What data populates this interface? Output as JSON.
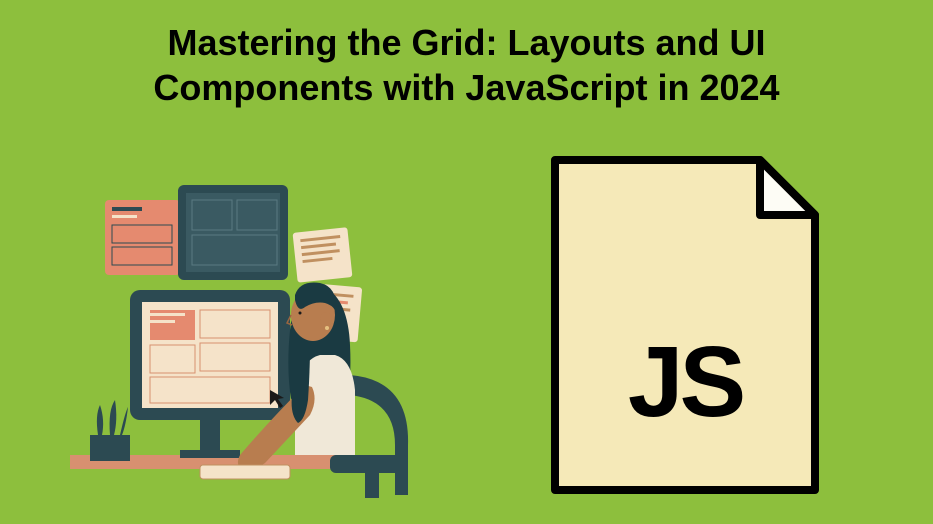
{
  "title": "Mastering the Grid: Layouts and UI Components with JavaScript in 2024",
  "file_label": "JS",
  "colors": {
    "background": "#8dbf3d",
    "file_fill": "#f5e9b8",
    "file_fold": "#fdfcf5",
    "text": "#000000"
  },
  "illustration": {
    "description": "developer-at-desk",
    "elements": {
      "monitor_color": "#2c4a52",
      "screen_bg": "#f5e3c9",
      "accent": "#e58a6f",
      "person_hair": "#1a3a42",
      "person_skin": "#b87d4f",
      "person_top": "#f0e8d8",
      "chair": "#2c4a52",
      "plant": "#2c4a52",
      "desk": "#d89070"
    }
  }
}
